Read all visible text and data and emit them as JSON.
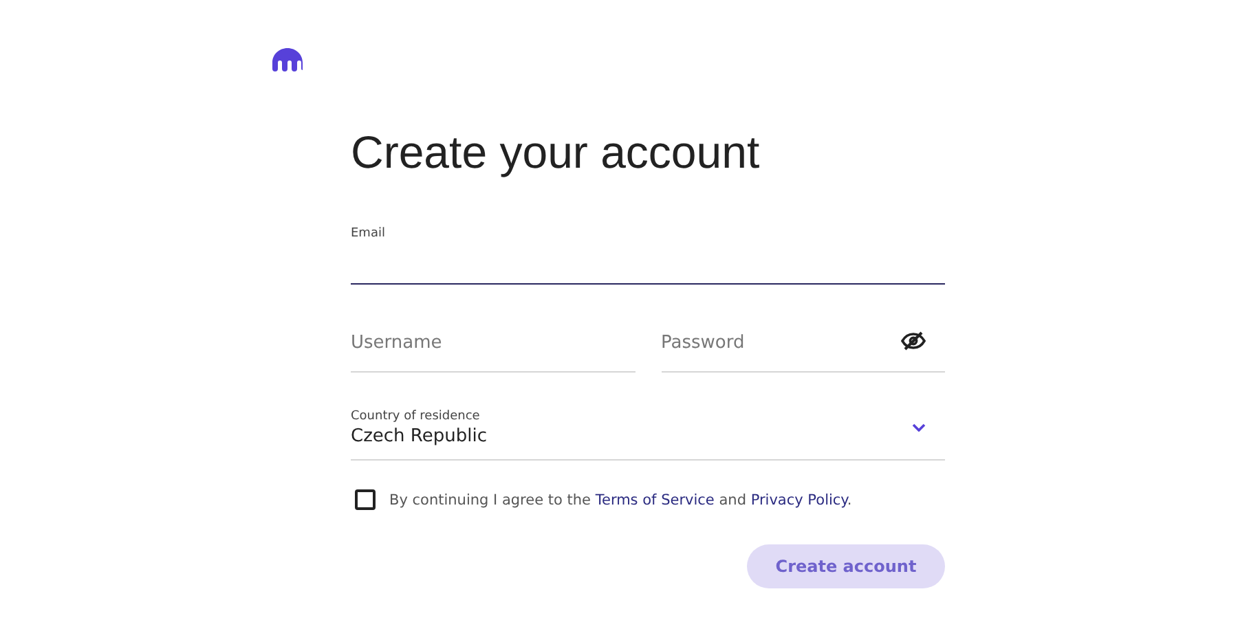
{
  "title": "Create your account",
  "email": {
    "label": "Email",
    "focused": true
  },
  "username": {
    "placeholder": "Username",
    "focused": false
  },
  "password": {
    "placeholder": "Password",
    "focused": false
  },
  "country": {
    "label": "Country of residence",
    "value": "Czech Republic"
  },
  "agreement": {
    "checked": false,
    "before": "By continuing I agree to the ",
    "terms": "Terms of Service",
    "middle": " and ",
    "privacy": "Privacy Policy",
    "after": "."
  },
  "submit": {
    "label": "Create account",
    "disabled": true
  }
}
